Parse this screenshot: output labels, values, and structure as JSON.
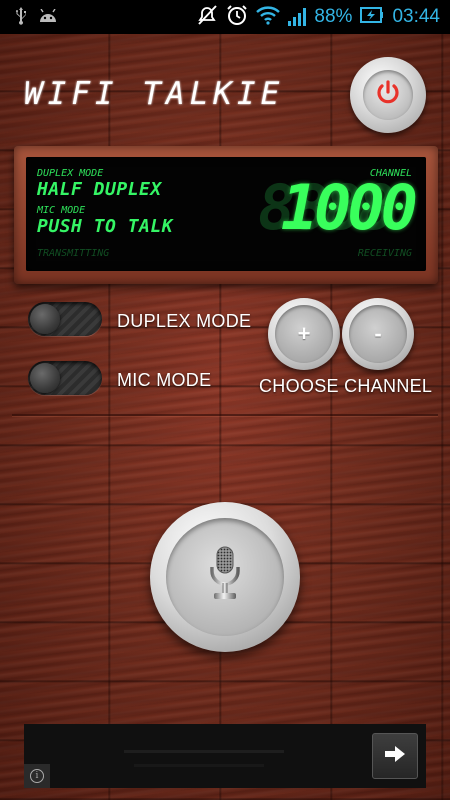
{
  "status_bar": {
    "battery_percent": "88%",
    "time": "03:44",
    "icons": [
      "usb-icon",
      "android-icon",
      "mute-icon",
      "alarm-icon",
      "wifi-icon",
      "signal-icon",
      "battery-icon"
    ]
  },
  "app": {
    "title": "WIFI TALKIE",
    "power_icon": "power-icon",
    "power_color": "#e8322a"
  },
  "display": {
    "duplex_mode_label": "DUPLEX MODE",
    "duplex_mode_value": "HALF DUPLEX",
    "mic_mode_label": "MIC MODE",
    "mic_mode_value": "PUSH TO TALK",
    "transmitting_label": "TRANSMITTING",
    "channel_label": "CHANNEL",
    "channel_value": "1000",
    "receiving_label": "RECEIVING",
    "lcd_color": "#39ff5c"
  },
  "controls": {
    "duplex_toggle_label": "DUPLEX MODE",
    "mic_toggle_label": "MIC MODE",
    "channel_up_label": "+",
    "channel_down_label": "-",
    "choose_channel_label": "CHOOSE CHANNEL",
    "talk_icon": "microphone-icon"
  },
  "ad_banner": {
    "arrow_icon": "arrow-right-icon",
    "info_icon": "info-icon",
    "info_glyph": "i"
  }
}
